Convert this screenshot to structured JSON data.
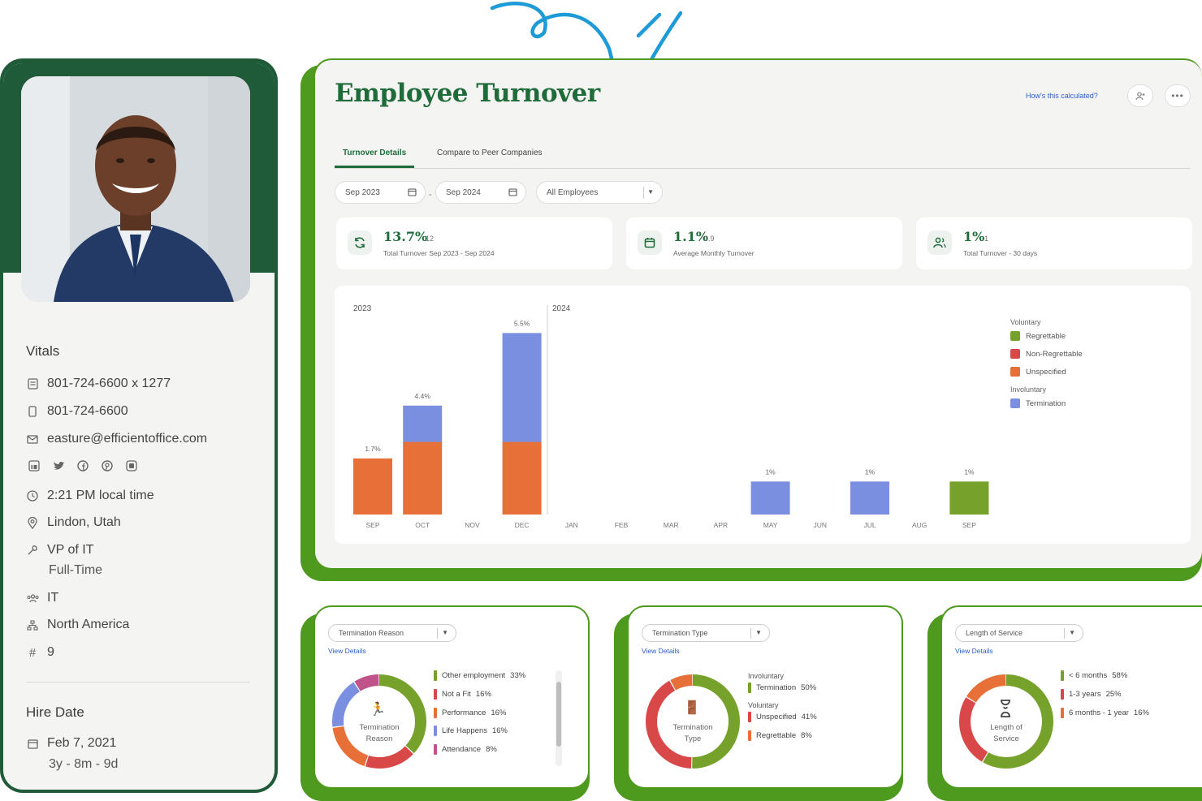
{
  "profile": {
    "vitals_title": "Vitals",
    "office_phone": "801-724-6600 x 1277",
    "mobile_phone": "801-724-6600",
    "email": "easture@efficientoffice.com",
    "local_time": "2:21 PM local time",
    "location": "Lindon, Utah",
    "job_title": "VP of IT",
    "employment_type": "Full-Time",
    "department": "IT",
    "division": "North America",
    "employee_number_symbol": "#",
    "employee_number": "9",
    "hire_title": "Hire Date",
    "hire_date": "Feb 7, 2021",
    "tenure": "3y - 8m - 9d"
  },
  "main": {
    "title": "Employee Turnover",
    "calc_link": "How's this calculated?",
    "tabs": [
      {
        "label": "Turnover Details",
        "active": true
      },
      {
        "label": "Compare to Peer Companies",
        "active": false
      }
    ],
    "filters": {
      "start": "Sep 2023",
      "dash": "-",
      "end": "Sep 2024",
      "employees": "All Employees"
    },
    "stats": [
      {
        "value": "13.7%",
        "count": "12",
        "desc": "Total Turnover Sep 2023 - Sep 2024",
        "icon": "refresh-icon"
      },
      {
        "value": "1.1%",
        "count": "0.9",
        "desc": "Average Monthly Turnover",
        "icon": "calendar-icon"
      },
      {
        "value": "1%",
        "count": "1",
        "desc": "Total Turnover - 30 days",
        "icon": "people-icon"
      }
    ]
  },
  "chart_data": {
    "type": "bar",
    "stacked": true,
    "year_labels": [
      "2023",
      "2024"
    ],
    "categories": [
      "SEP",
      "OCT",
      "NOV",
      "DEC",
      "JAN",
      "FEB",
      "MAR",
      "APR",
      "MAY",
      "JUN",
      "JUL",
      "AUG",
      "SEP"
    ],
    "totals_labels": [
      "1.7%",
      "4.4%",
      "",
      "5.5%",
      "",
      "",
      "",
      "",
      "1%",
      "",
      "1%",
      "",
      "1%"
    ],
    "series": [
      {
        "name": "Regrettable",
        "group": "Voluntary",
        "color": "#76a12a",
        "values": [
          0,
          0,
          0,
          0,
          0,
          0,
          0,
          0,
          0,
          0,
          0,
          0,
          1
        ]
      },
      {
        "name": "Non-Regrettable",
        "group": "Voluntary",
        "color": "#d94848",
        "values": [
          0,
          0,
          0,
          0,
          0,
          0,
          0,
          0,
          0,
          0,
          0,
          0,
          0
        ]
      },
      {
        "name": "Unspecified",
        "group": "Voluntary",
        "color": "#e76f38",
        "values": [
          1.7,
          2.2,
          0,
          2.2,
          0,
          0,
          0,
          0,
          0,
          0,
          0,
          0,
          0
        ]
      },
      {
        "name": "Termination",
        "group": "Involuntary",
        "color": "#7a8fe0",
        "values": [
          0,
          1.1,
          0,
          3.3,
          0,
          0,
          0,
          0,
          1,
          0,
          1,
          0,
          0
        ]
      }
    ],
    "legend_groups": [
      "Voluntary",
      "Involuntary"
    ],
    "ylim": [
      0,
      6
    ]
  },
  "bottom": {
    "reason": {
      "dropdown": "Termination Reason",
      "view": "View Details",
      "center": [
        "Termination",
        "Reason"
      ],
      "items": [
        {
          "label": "Other employment",
          "pct": "33%",
          "value": 33,
          "color": "#76a12a"
        },
        {
          "label": "Not a Fit",
          "pct": "16%",
          "value": 16,
          "color": "#d94848"
        },
        {
          "label": "Performance",
          "pct": "16%",
          "value": 16,
          "color": "#e76f38"
        },
        {
          "label": "Life Happens",
          "pct": "16%",
          "value": 16,
          "color": "#7a8fe0"
        },
        {
          "label": "Attendance",
          "pct": "8%",
          "value": 8,
          "color": "#c0538a"
        }
      ]
    },
    "type": {
      "dropdown": "Termination Type",
      "view": "View Details",
      "center": [
        "Termination",
        "Type"
      ],
      "group1": "Involuntary",
      "group2": "Voluntary",
      "items": [
        {
          "label": "Termination",
          "pct": "50%",
          "value": 50,
          "color": "#76a12a"
        },
        {
          "label": "Unspecified",
          "pct": "41%",
          "value": 41,
          "color": "#d94848"
        },
        {
          "label": "Regrettable",
          "pct": "8%",
          "value": 8,
          "color": "#e76f38"
        }
      ]
    },
    "service": {
      "dropdown": "Length of Service",
      "view": "View Details",
      "center": [
        "Length of",
        "Service"
      ],
      "items": [
        {
          "label": "< 6 months",
          "pct": "58%",
          "value": 58,
          "color": "#76a12a"
        },
        {
          "label": "1-3 years",
          "pct": "25%",
          "value": 25,
          "color": "#d94848"
        },
        {
          "label": "6 months - 1 year",
          "pct": "16%",
          "value": 16,
          "color": "#e76f38"
        }
      ]
    }
  }
}
